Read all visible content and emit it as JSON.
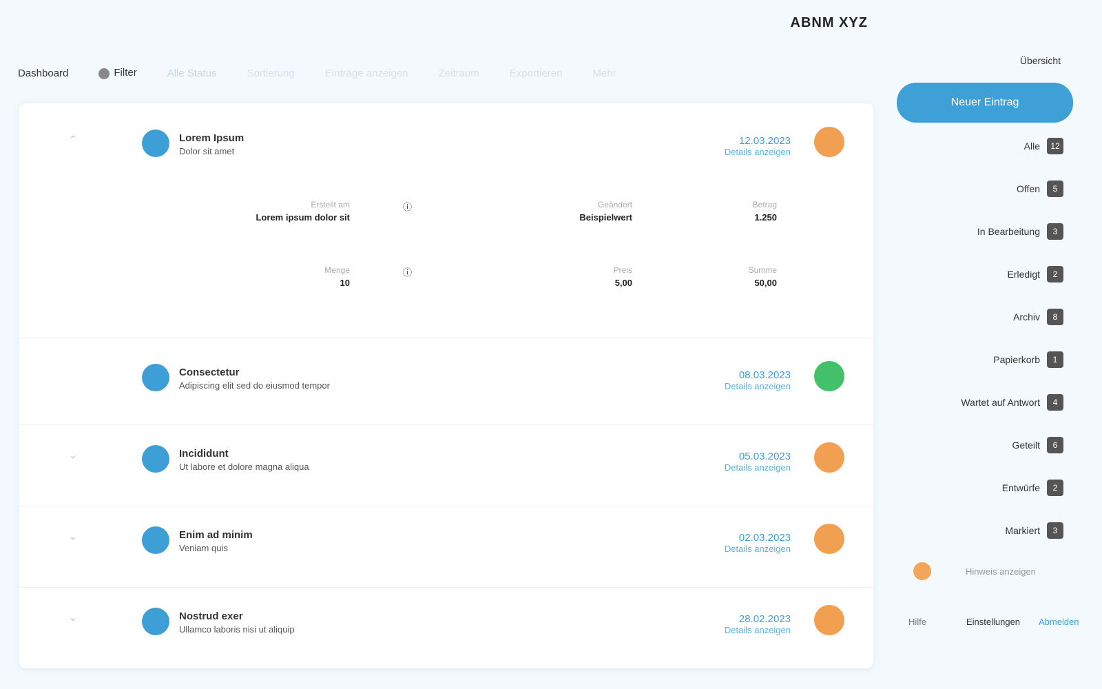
{
  "topbar": {
    "account_label": "ABNM XYZ"
  },
  "tabs": [
    {
      "label": "Dashboard",
      "style": "normal"
    },
    {
      "label": "Filter",
      "style": "normal"
    },
    {
      "label": "Alle Status",
      "style": "muted"
    },
    {
      "label": "Sortierung",
      "style": "dim"
    },
    {
      "label": "Einträge anzeigen",
      "style": "dim"
    },
    {
      "label": "Zeitraum",
      "style": "dim"
    },
    {
      "label": "Exportieren",
      "style": "dim"
    },
    {
      "label": "Mehr",
      "style": "dim"
    }
  ],
  "rows": [
    {
      "title": "Lorem Ipsum",
      "subtitle": "Dolor sit amet",
      "link_main": "12.03.2023",
      "link_sub": "Details anzeigen",
      "status": "pending",
      "expanded": true,
      "details": [
        {
          "label": "Erstellt am",
          "value": "Lorem ipsum dolor sit"
        },
        {
          "label": "Geändert",
          "value": "Beispielwert"
        },
        {
          "label": "Betrag",
          "value": "1.250"
        }
      ],
      "details2": [
        {
          "label": "Menge",
          "value": "10"
        },
        {
          "label": "Preis",
          "value": "5,00"
        },
        {
          "label": "Summe",
          "value": "50,00"
        }
      ]
    },
    {
      "title": "Consectetur",
      "subtitle": "Adipiscing elit sed do eiusmod tempor",
      "link_main": "08.03.2023",
      "link_sub": "Details anzeigen",
      "status": "ok",
      "expanded": false
    },
    {
      "title": "Incididunt",
      "subtitle": "Ut labore et dolore magna aliqua",
      "link_main": "05.03.2023",
      "link_sub": "Details anzeigen",
      "status": "pending",
      "expanded": false
    },
    {
      "title": "Enim ad minim",
      "subtitle": "Veniam quis",
      "link_main": "02.03.2023",
      "link_sub": "Details anzeigen",
      "status": "pending",
      "expanded": false
    },
    {
      "title": "Nostrud exer",
      "subtitle": "Ullamco laboris nisi ut aliquip",
      "link_main": "28.02.2023",
      "link_sub": "Details anzeigen",
      "status": "pending",
      "expanded": false
    }
  ],
  "sidebar": {
    "top_label": "Übersicht",
    "primary_button": "Neuer Eintrag",
    "items": [
      {
        "label": "Alle",
        "count": "12"
      },
      {
        "label": "Offen",
        "count": "5"
      },
      {
        "label": "In Bearbeitung",
        "count": "3"
      },
      {
        "label": "Erledigt",
        "count": "2"
      },
      {
        "label": "Archiv",
        "count": "8"
      },
      {
        "label": "Papierkorb",
        "count": "1"
      },
      {
        "label": "Wartet auf Antwort",
        "count": "4"
      },
      {
        "label": "Geteilt",
        "count": "6"
      },
      {
        "label": "Entwürfe",
        "count": "2"
      },
      {
        "label": "Markiert",
        "count": "3"
      }
    ],
    "footer_note": "Hinweis anzeigen",
    "footer_buttons": [
      "Hilfe",
      "Einstellungen",
      "Abmelden"
    ]
  }
}
